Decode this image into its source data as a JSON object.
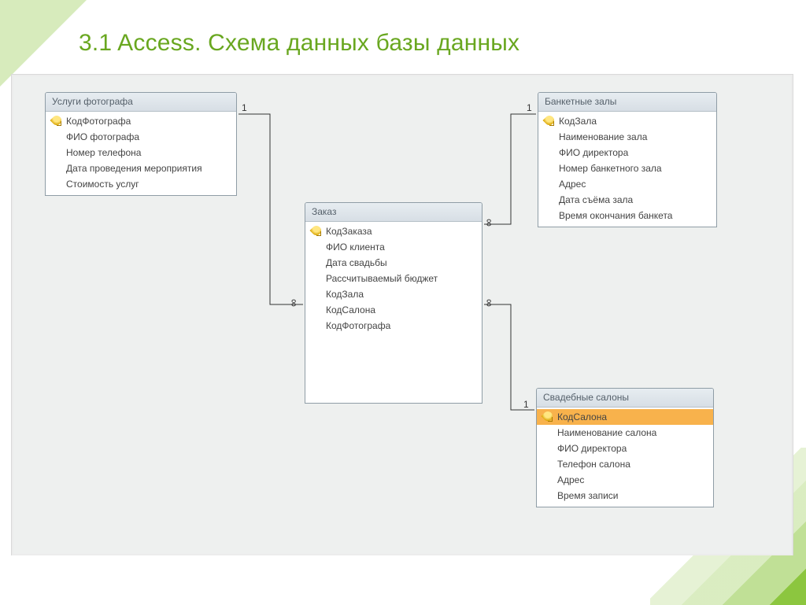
{
  "page_title": "3.1 Access. Схема данных базы данных",
  "tables": {
    "photo": {
      "title": "Услуги фотографа",
      "fields": [
        {
          "name": "КодФотографа",
          "pk": true
        },
        {
          "name": "ФИО фотографа"
        },
        {
          "name": "Номер телефона"
        },
        {
          "name": "Дата проведения мероприятия"
        },
        {
          "name": "Стоимость услуг"
        }
      ]
    },
    "order": {
      "title": "Заказ",
      "fields": [
        {
          "name": "КодЗаказа",
          "pk": true
        },
        {
          "name": "ФИО клиента"
        },
        {
          "name": "Дата свадьбы"
        },
        {
          "name": "Рассчитываемый бюджет"
        },
        {
          "name": "КодЗала"
        },
        {
          "name": "КодСалона"
        },
        {
          "name": "КодФотографа"
        }
      ]
    },
    "halls": {
      "title": "Банкетные залы",
      "fields": [
        {
          "name": "КодЗала",
          "pk": true
        },
        {
          "name": "Наименование зала"
        },
        {
          "name": "ФИО директора"
        },
        {
          "name": "Номер банкетного зала"
        },
        {
          "name": "Адрес"
        },
        {
          "name": "Дата съёма зала"
        },
        {
          "name": "Время окончания банкета"
        }
      ]
    },
    "salons": {
      "title": "Свадебные салоны",
      "fields": [
        {
          "name": "КодСалона",
          "pk": true,
          "selected": true
        },
        {
          "name": "Наименование салона"
        },
        {
          "name": "ФИО директора"
        },
        {
          "name": "Телефон салона"
        },
        {
          "name": "Адрес"
        },
        {
          "name": "Время записи"
        }
      ]
    }
  },
  "relationships": [
    {
      "from": "photo",
      "to": "order",
      "from_card": "1",
      "to_card": "∞"
    },
    {
      "from": "halls",
      "to": "order",
      "from_card": "1",
      "to_card": "∞"
    },
    {
      "from": "salons",
      "to": "order",
      "from_card": "1",
      "to_card": "∞"
    }
  ],
  "cardinality_labels": {
    "one": "1",
    "many": "∞"
  }
}
